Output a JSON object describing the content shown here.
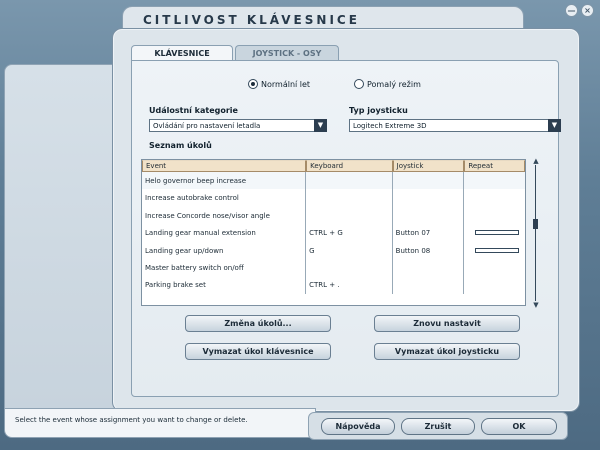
{
  "window": {
    "title": "CITLIVOST KLÁVESNICE"
  },
  "corner": {
    "minimize": "—",
    "close": "×"
  },
  "tabs": [
    {
      "label": "KLÁVESNICE",
      "active": true
    },
    {
      "label": "JOYSTICK - OSY",
      "active": false
    }
  ],
  "mode": {
    "normal": {
      "label": "Normální let",
      "selected": true
    },
    "slow": {
      "label": "Pomalý režim",
      "selected": false
    }
  },
  "category": {
    "label": "Událostní kategorie",
    "value": "Ovládání pro nastavení letadla"
  },
  "joystick_type": {
    "label": "Typ joysticku",
    "value": "Logitech Extreme 3D"
  },
  "task_list": {
    "label": "Seznam úkolů",
    "columns": [
      "Event",
      "Keyboard",
      "Joystick",
      "Repeat"
    ],
    "rows": [
      {
        "event": "Helo governor beep increase",
        "keyboard": "",
        "joystick": "",
        "repeat": null,
        "selected": true
      },
      {
        "event": "Increase autobrake control",
        "keyboard": "",
        "joystick": "",
        "repeat": null
      },
      {
        "event": "Increase Concorde nose/visor angle",
        "keyboard": "",
        "joystick": "",
        "repeat": null
      },
      {
        "event": "Landing gear manual extension",
        "keyboard": "CTRL + G",
        "joystick": "Button 07",
        "repeat": 0.0
      },
      {
        "event": "Landing gear up/down",
        "keyboard": "G",
        "joystick": "Button 08",
        "repeat": 0.0
      },
      {
        "event": "Master battery switch on/off",
        "keyboard": "",
        "joystick": "",
        "repeat": null
      },
      {
        "event": "Parking brake set",
        "keyboard": "CTRL + .",
        "joystick": "",
        "repeat": null
      }
    ]
  },
  "buttons": {
    "change_task": "Změna úkolů...",
    "reset": "Znovu nastavit",
    "clear_keyboard": "Vymazat úkol klávesnice",
    "clear_joystick": "Vymazat úkol joysticku"
  },
  "status": {
    "text": "Select the event whose assignment you want to change or delete."
  },
  "footer": {
    "help": "Nápověda",
    "cancel": "Zrušit",
    "ok": "OK"
  },
  "colors": {
    "header": "#f1e2c9",
    "accent": "#2c3e50",
    "background": "#5f7e96"
  },
  "icons": {
    "minimize": "minimize-icon",
    "close": "close-icon",
    "dropdown": "chevron-down-icon"
  }
}
